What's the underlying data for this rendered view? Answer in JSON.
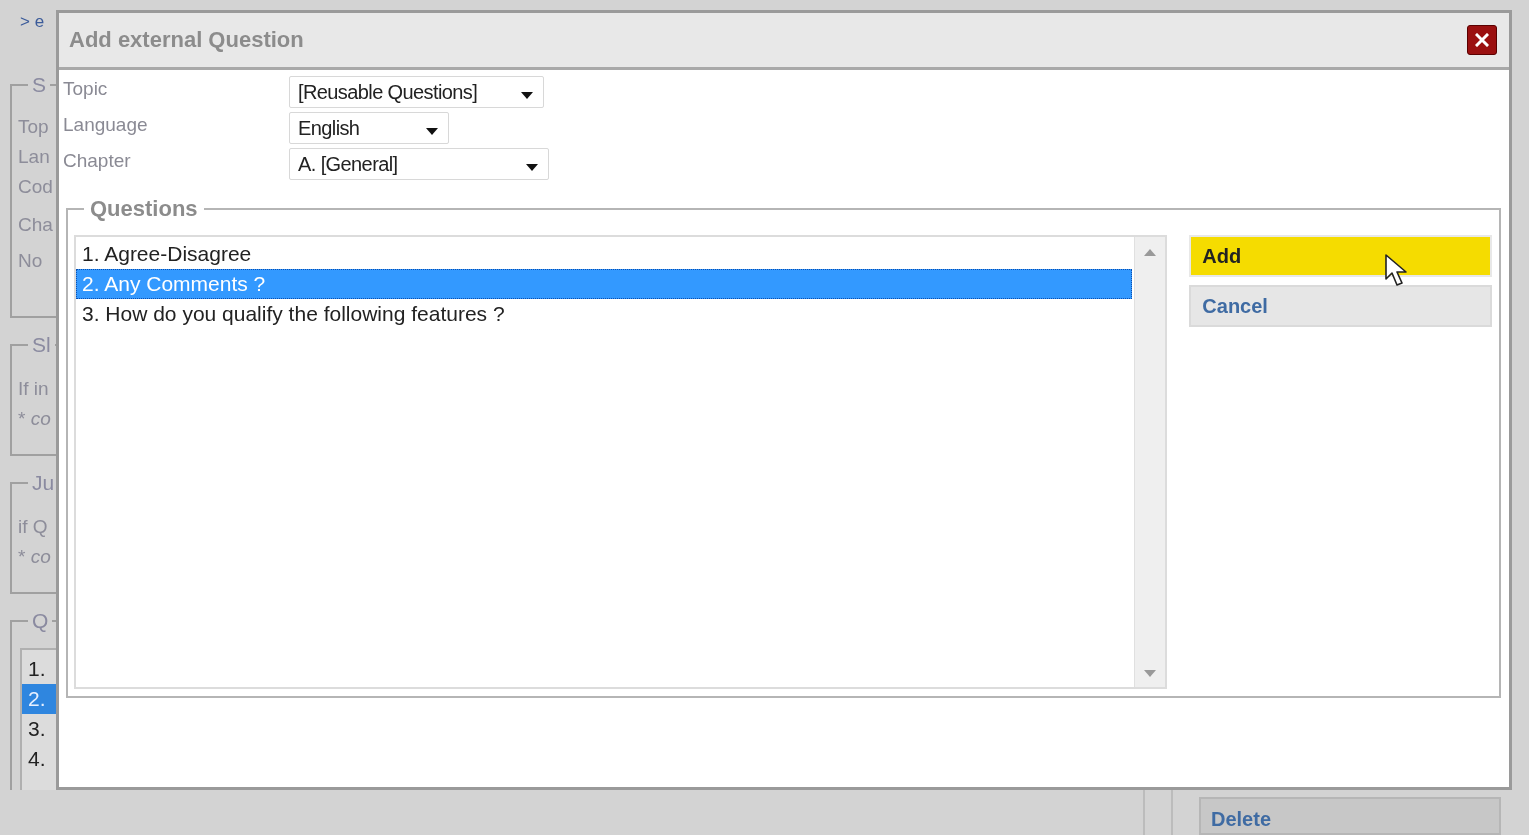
{
  "background": {
    "breadcrumb": "> e",
    "sections": [
      {
        "legend": "S",
        "kind": "labels",
        "lines": [
          "Top",
          "Lan",
          "Cod",
          "Cha",
          "No"
        ]
      },
      {
        "legend": "Sl",
        "kind": "text",
        "lines": [
          "If in",
          "* *co*"
        ]
      },
      {
        "legend": "Ju",
        "kind": "text",
        "lines": [
          "if Q",
          "* *co*"
        ]
      },
      {
        "legend": "Q",
        "kind": "list",
        "items": [
          {
            "text": "1.",
            "selected": false
          },
          {
            "text": "2.",
            "selected": true
          },
          {
            "text": "3.",
            "selected": false
          },
          {
            "text": "4.",
            "selected": false
          }
        ]
      }
    ],
    "delete_button": "Delete"
  },
  "dialog": {
    "title": "Add external Question",
    "fields": [
      {
        "label": "Topic",
        "value": "[Reusable Questions]"
      },
      {
        "label": "Language",
        "value": "English"
      },
      {
        "label": "Chapter",
        "value": "A. [General]"
      }
    ],
    "questions": {
      "legend": "Questions",
      "items": [
        {
          "text": "1. Agree-Disagree",
          "selected": false
        },
        {
          "text": "2. Any Comments ?",
          "selected": true
        },
        {
          "text": "3. How do you qualify the following features ?",
          "selected": false
        }
      ]
    },
    "buttons": [
      {
        "label": "Add",
        "kind": "primary"
      },
      {
        "label": "Cancel",
        "kind": "secondary"
      }
    ]
  }
}
